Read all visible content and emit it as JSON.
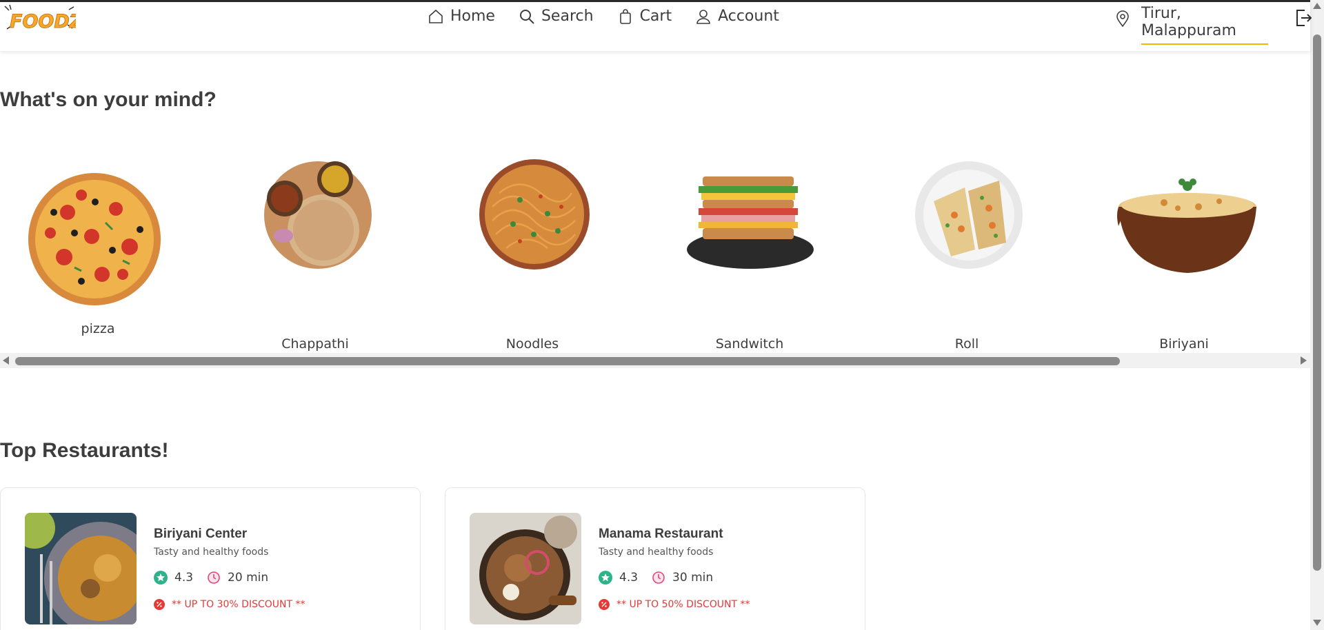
{
  "header": {
    "logo_text": "FOODZ",
    "nav": [
      {
        "label": "Home",
        "icon": "home-icon"
      },
      {
        "label": "Search",
        "icon": "search-icon"
      },
      {
        "label": "Cart",
        "icon": "cart-icon"
      },
      {
        "label": "Account",
        "icon": "account-icon"
      }
    ],
    "location": "Tirur, Malappuram",
    "location_icon": "location-pin-icon",
    "logout_icon": "logout-icon"
  },
  "categories_section": {
    "title": "What's on your mind?",
    "items": [
      {
        "label": "pizza",
        "image": "pizza"
      },
      {
        "label": "Chappathi",
        "image": "chappathi"
      },
      {
        "label": "Noodles",
        "image": "noodles"
      },
      {
        "label": "Sandwitch",
        "image": "sandwitch"
      },
      {
        "label": "Roll",
        "image": "roll"
      },
      {
        "label": "Biriyani",
        "image": "biriyani"
      }
    ]
  },
  "restaurants_section": {
    "title": "Top Restaurants!",
    "items": [
      {
        "name": "Biriyani Center",
        "description": "Tasty and healthy foods",
        "rating": "4.3",
        "time": "20 min",
        "discount": "** UP TO 30% DISCOUNT **"
      },
      {
        "name": "Manama Restaurant",
        "description": "Tasty and healthy foods",
        "rating": "4.3",
        "time": "30 min",
        "discount": "** UP TO 50% DISCOUNT **"
      }
    ]
  },
  "colors": {
    "accent": "#f5b400",
    "rating_green": "#2bb38a",
    "clock_pink": "#e0457b",
    "discount_red": "#e53935"
  }
}
